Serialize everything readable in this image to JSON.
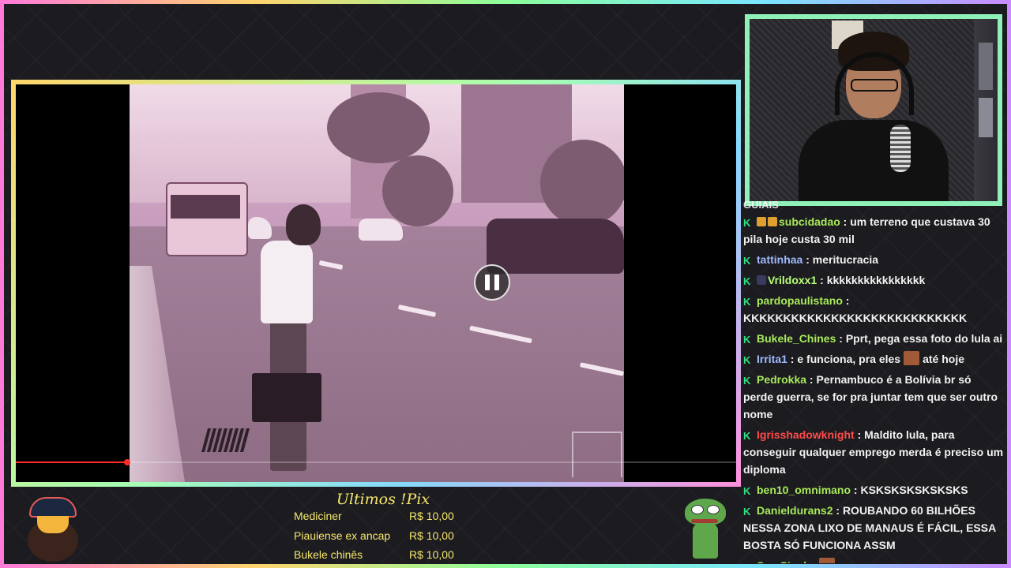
{
  "video": {
    "progress": 0.155,
    "state": "paused"
  },
  "chat": {
    "header": "GUIAIS",
    "messages": [
      {
        "user": "subcidadao",
        "color": "#a8e95a",
        "text": "um terreno que custava 30 pila hoje custa 30 mil",
        "badges": [
          "#e0a030",
          "#e0a030"
        ]
      },
      {
        "user": "tattinhaa",
        "color": "#9fb8ff",
        "text": "meritucracia"
      },
      {
        "user": "Vrildoxx1",
        "color": "#b8ff7a",
        "text": "kkkkkkkkkkkkkkkk",
        "badges": [
          "#3a3a60"
        ]
      },
      {
        "user": "pardopaulistano",
        "color": "#a8e95a",
        "text": "KKKKKKKKKKKKKKKKKKKKKKKKKKKK"
      },
      {
        "user": "Bukele_Chines",
        "color": "#a8e95a",
        "text": "Pprt, pega essa foto do lula ai"
      },
      {
        "user": "Irrita1",
        "color": "#9fb8ff",
        "text_before": "e funciona, pra eles",
        "text_after": "até hoje",
        "emote": "emote"
      },
      {
        "user": "Pedrokka",
        "color": "#a8e95a",
        "text": "Pernambuco é a Bolívia br só perde guerra, se for pra juntar tem que ser outro nome"
      },
      {
        "user": "Igrisshadowknight",
        "color": "#ff4a4a",
        "text": "Maldito lula, para conseguir qualquer emprego merda é preciso um diploma"
      },
      {
        "user": "ben10_omnimano",
        "color": "#a8e95a",
        "text": "KSKSKSKSKSKSKS"
      },
      {
        "user": "Danieldurans2",
        "color": "#a8e95a",
        "text": "ROUBANDO 60 BILHÕES NESSA ZONA LIXO DE MANAUS É FÁCIL, ESSA BOSTA SÓ FUNCIONA ASSM"
      },
      {
        "user": "SemSinal",
        "color": "#a8e95a",
        "text": "",
        "emote": "emote"
      }
    ]
  },
  "pix": {
    "title": "Ultimos !Pix",
    "donations": [
      {
        "name": "Mediciner",
        "amount": "R$ 10,00"
      },
      {
        "name": "Piauiense ex ancap",
        "amount": "R$ 10,00"
      },
      {
        "name": "Bukele chinês",
        "amount": "R$ 10,00"
      }
    ]
  },
  "colors": {
    "pix_text": "#f5e66c",
    "kick_green": "#2ee47f",
    "progress": "#ff2a2a"
  },
  "icons": {
    "pause": "pause-icon",
    "kick": "kick-logo-icon",
    "mascot": "mascot-emote",
    "pepe": "pepe-emote"
  }
}
